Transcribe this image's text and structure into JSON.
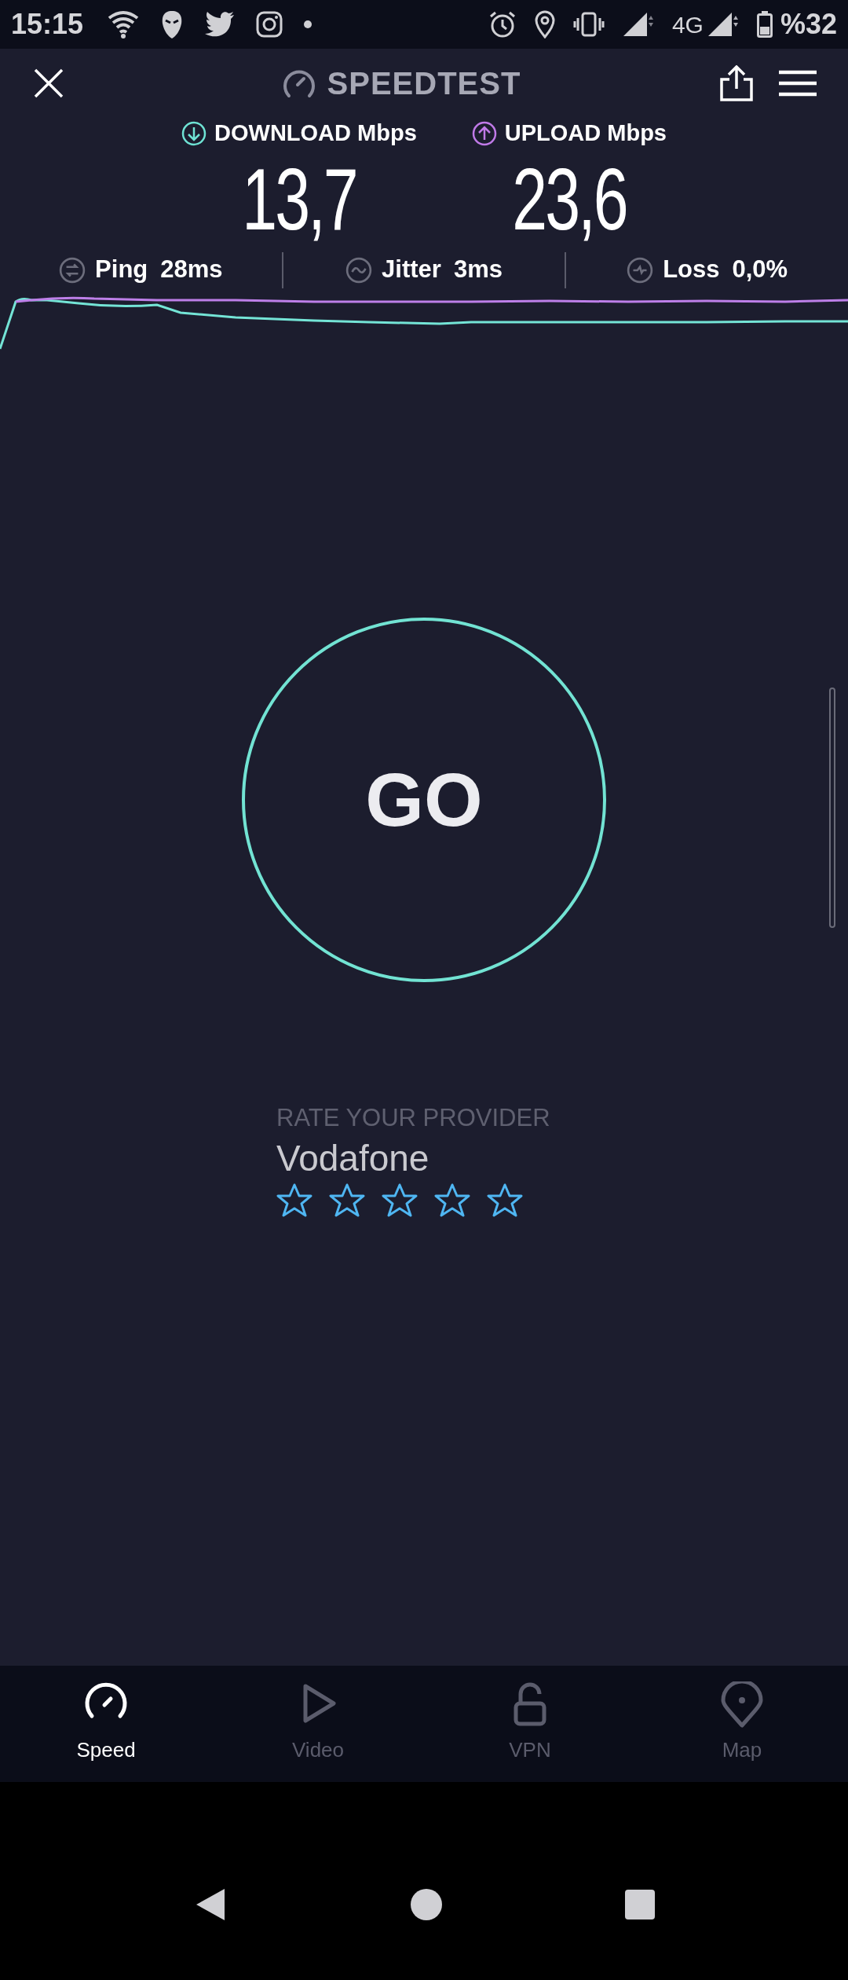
{
  "status_bar": {
    "time": "15:15",
    "network": "4G",
    "battery": "%32"
  },
  "header": {
    "title": "SPEEDTEST"
  },
  "results": [
    {
      "kind": "download",
      "label": "DOWNLOAD Mbps",
      "value": "13,7"
    },
    {
      "kind": "upload",
      "label": "UPLOAD Mbps",
      "value": "23,6"
    }
  ],
  "metrics": [
    {
      "kind": "ping",
      "label": "Ping",
      "value": "28ms"
    },
    {
      "kind": "jitter",
      "label": "Jitter",
      "value": "3ms"
    },
    {
      "kind": "loss",
      "label": "Loss",
      "value": "0,0%"
    }
  ],
  "go_button": {
    "label": "GO"
  },
  "rating": {
    "heading": "RATE YOUR PROVIDER",
    "provider": "Vodafone",
    "stars": 0
  },
  "nav": [
    {
      "kind": "speed",
      "label": "Speed",
      "selected": true
    },
    {
      "kind": "video",
      "label": "Video",
      "selected": false
    },
    {
      "kind": "vpn",
      "label": "VPN",
      "selected": false
    },
    {
      "kind": "map",
      "label": "Map",
      "selected": false
    }
  ]
}
